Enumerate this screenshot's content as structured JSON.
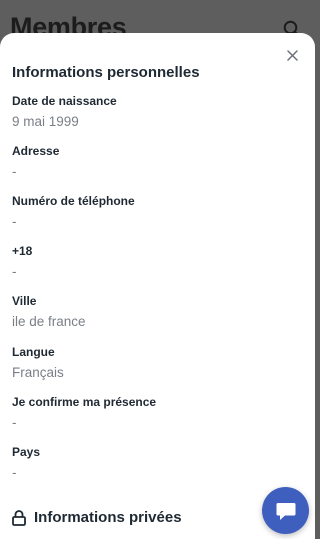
{
  "background": {
    "title": "Membres",
    "search_icon": "search-icon"
  },
  "sheet": {
    "close_icon": "close-icon",
    "section_title": "Informations personnelles",
    "fields": [
      {
        "label": "Date de naissance",
        "value": "9 mai 1999"
      },
      {
        "label": "Adresse",
        "value": "-"
      },
      {
        "label": "Numéro de téléphone",
        "value": "-"
      },
      {
        "label": "+18",
        "value": "-"
      },
      {
        "label": "Ville",
        "value": "ile de france"
      },
      {
        "label": "Langue",
        "value": "Français"
      },
      {
        "label": "Je confirme ma présence",
        "value": "-"
      },
      {
        "label": "Pays",
        "value": "-"
      }
    ],
    "private_section": {
      "icon": "lock-icon",
      "title": "Informations privées"
    }
  },
  "chat_button": {
    "icon": "chat-bubble-icon",
    "color": "#3f5fbf"
  },
  "colors": {
    "overlay": "#5e5e5e",
    "text_primary": "#1f2933",
    "text_secondary": "#7a7f86"
  }
}
